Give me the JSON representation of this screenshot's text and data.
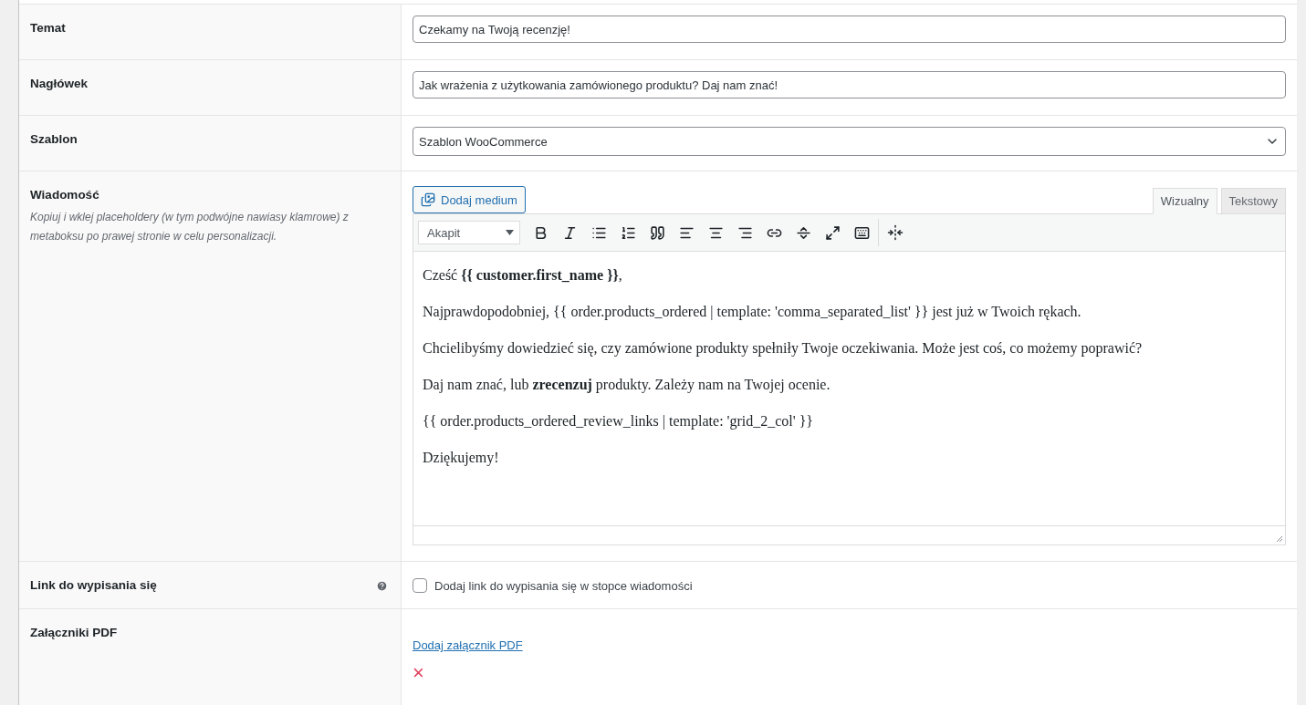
{
  "fields": [
    {
      "kind": "text",
      "label": "Temat",
      "value": "Czekamy na Twoją recenzję!"
    },
    {
      "kind": "text",
      "label": "Nagłówek",
      "value": "Jak wrażenia z użytkowania zamówionego produktu? Daj nam znać!"
    },
    {
      "kind": "select",
      "label": "Szablon",
      "value": "Szablon WooCommerce"
    },
    {
      "kind": "editor",
      "label": "Wiadomość",
      "description": "Kopiuj i wklej placeholdery (w tym podwójne nawiasy klamrowe) z metaboksu po prawej stronie w celu personalizacji.",
      "media_button": "Dodaj medium",
      "tabs": [
        {
          "label": "Wizualny",
          "selected": true
        },
        {
          "label": "Tekstowy",
          "selected": false
        }
      ],
      "format": "Akapit",
      "paragraphs": [
        "Cześć **{{ customer.first_name }}**,",
        "Najprawdopodobniej, {{ order.products_ordered | template: 'comma_separated_list' }} jest już w Twoich rękach.",
        "Chcielibyśmy dowiedzieć się, czy zamówione produkty spełniły Twoje oczekiwania. Może jest coś, co możemy poprawić?",
        "Daj nam znać, lub **zrecenzuj** produkty. Zależy nam na Twojej ocenie.",
        "{{ order.products_ordered_review_links | template: 'grid_2_col' }}",
        "Dziękujemy!"
      ]
    },
    {
      "kind": "checkbox",
      "label": "Link do wypisania się",
      "help": true,
      "option": "Dodaj link do wypisania się w stopce wiadomości",
      "checked": false
    },
    {
      "kind": "attachments",
      "label": "Załączniki PDF",
      "link": "Dodaj załącznik PDF",
      "remove": "×"
    }
  ]
}
